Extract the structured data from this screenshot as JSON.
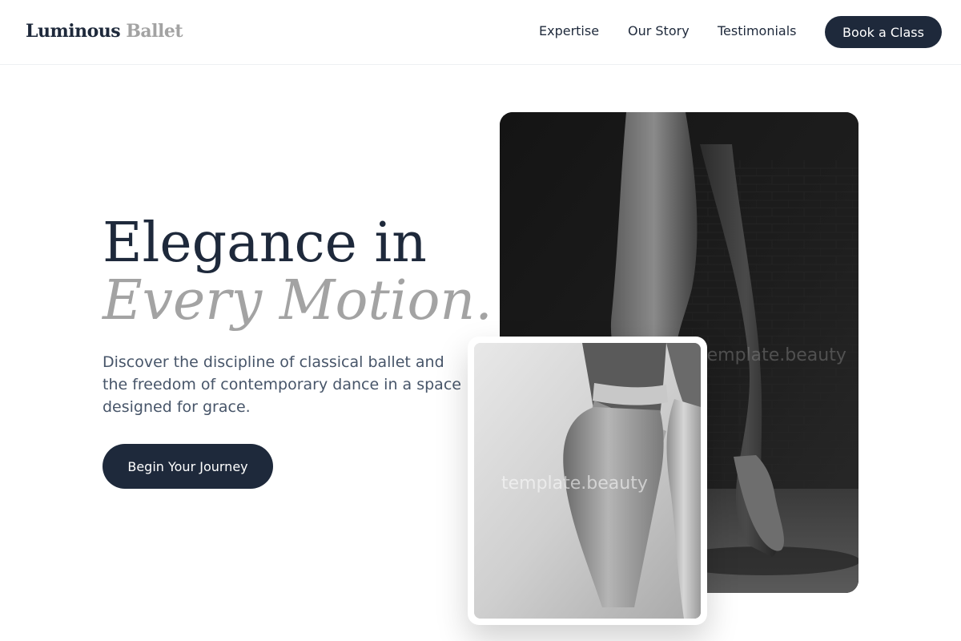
{
  "brand": {
    "name_primary": "Luminous",
    "name_accent": "Ballet"
  },
  "nav": {
    "items": [
      {
        "label": "Expertise"
      },
      {
        "label": "Our Story"
      },
      {
        "label": "Testimonials"
      }
    ],
    "cta_label": "Book a Class"
  },
  "hero": {
    "headline_line1": "Elegance in",
    "headline_line2": "Every Motion.",
    "subtext": "Discover the discipline of classical ballet and the freedom of contemporary dance in a space designed for grace.",
    "cta_label": "Begin Your Journey"
  },
  "images": {
    "main_watermark": "template.beauty",
    "small_watermark": "template.beauty"
  },
  "colors": {
    "primary": "#1e293b",
    "accent_gray": "#a3a3a3",
    "body_text": "#475569"
  }
}
